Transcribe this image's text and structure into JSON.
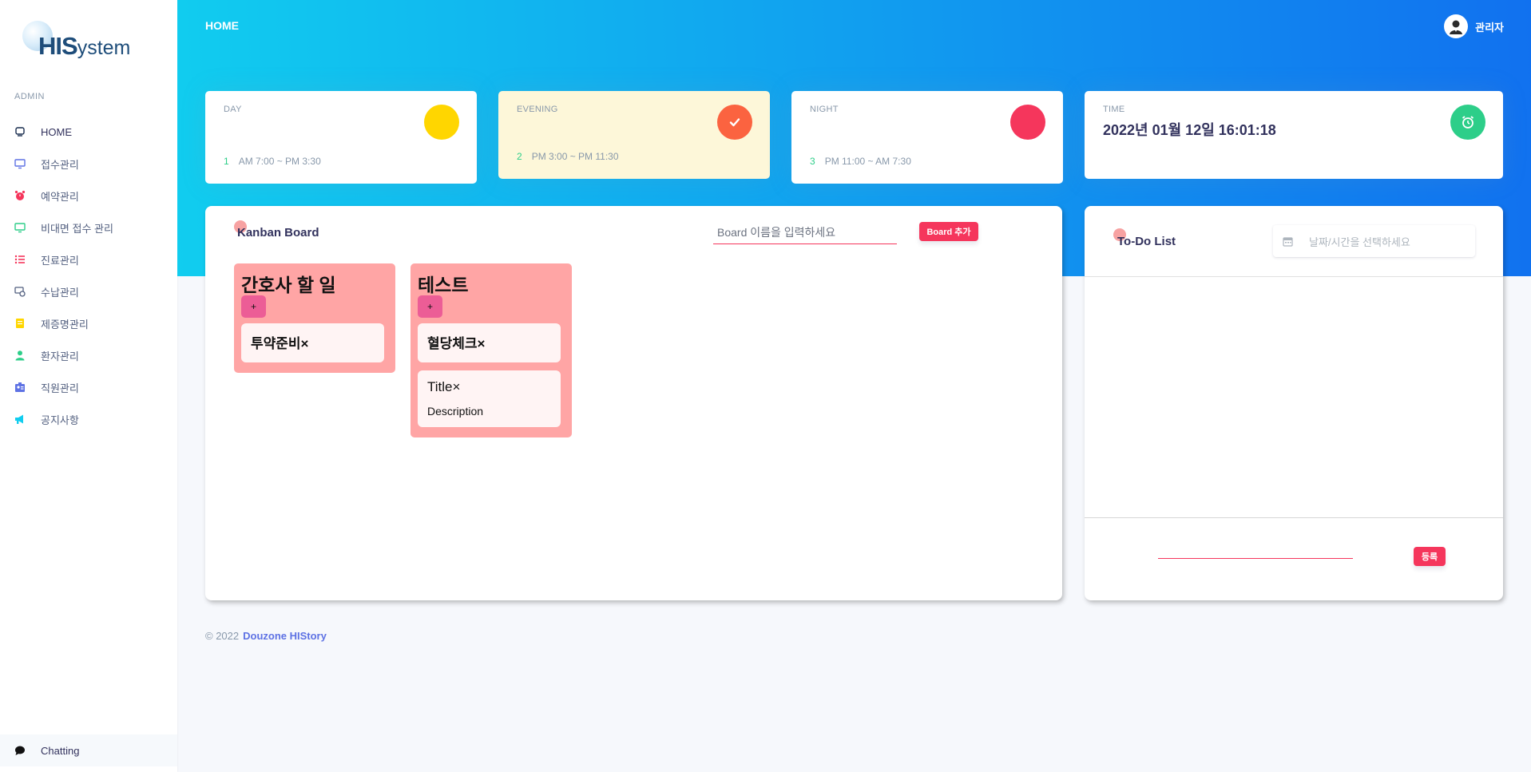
{
  "app": {
    "logo_text_big": "HIS",
    "logo_text_small": "ystem"
  },
  "sidebar": {
    "heading": "ADMIN",
    "items": [
      {
        "label": "HOME",
        "icon": "tv-icon",
        "color": "#172b4d"
      },
      {
        "label": "접수관리",
        "icon": "monitor-icon",
        "color": "#5e72e4"
      },
      {
        "label": "예약관리",
        "icon": "alarm-clock-icon",
        "color": "#f5365c"
      },
      {
        "label": "비대면 접수 관리",
        "icon": "laptop-icon",
        "color": "#2dce89"
      },
      {
        "label": "진료관리",
        "icon": "list-icon",
        "color": "#f5365c"
      },
      {
        "label": "수납관리",
        "icon": "receipt-icon",
        "color": "#525f7f"
      },
      {
        "label": "제증명관리",
        "icon": "note-icon",
        "color": "#ffd600"
      },
      {
        "label": "환자관리",
        "icon": "user-icon",
        "color": "#2dce89"
      },
      {
        "label": "직원관리",
        "icon": "badge-icon",
        "color": "#5e72e4"
      },
      {
        "label": "공지사항",
        "icon": "megaphone-icon",
        "color": "#11cdef"
      }
    ],
    "chat_label": "Chatting"
  },
  "header": {
    "breadcrumb": "HOME",
    "user_name": "관리자"
  },
  "stats": [
    {
      "title": "DAY",
      "num": "1",
      "range": "AM 7:00 ~ PM 3:30",
      "circle_color": "#ffd600",
      "bg": "#ffffff"
    },
    {
      "title": "EVENING",
      "num": "2",
      "range": "PM 3:00 ~ PM 11:30",
      "circle_color": "#fb6340",
      "bg": "#fdf7d9"
    },
    {
      "title": "NIGHT",
      "num": "3",
      "range": "PM 11:00 ~ AM 7:30",
      "circle_color": "#f5365c",
      "bg": "#ffffff"
    },
    {
      "title": "TIME",
      "value": "2022년 01월 12일 16:01:18",
      "circle_color": "#2dce89"
    }
  ],
  "kanban": {
    "title": "Kanban Board",
    "input_placeholder": "Board 이름을 입력하세요",
    "add_button": "Board 추가",
    "columns": [
      {
        "title": "간호사 할 일",
        "add_label": "+",
        "cards": [
          {
            "title": "투약준비×"
          }
        ]
      },
      {
        "title": "테스트",
        "add_label": "+",
        "cards": [
          {
            "title": "혈당체크×"
          },
          {
            "title": "Title×",
            "description": "Description"
          }
        ]
      }
    ]
  },
  "todo": {
    "title": "To-Do List",
    "date_placeholder": "날짜/시간을 선택하세요",
    "submit_label": "등록"
  },
  "footer": {
    "copyright": "© 2022",
    "brand": "Douzone HIStory"
  }
}
